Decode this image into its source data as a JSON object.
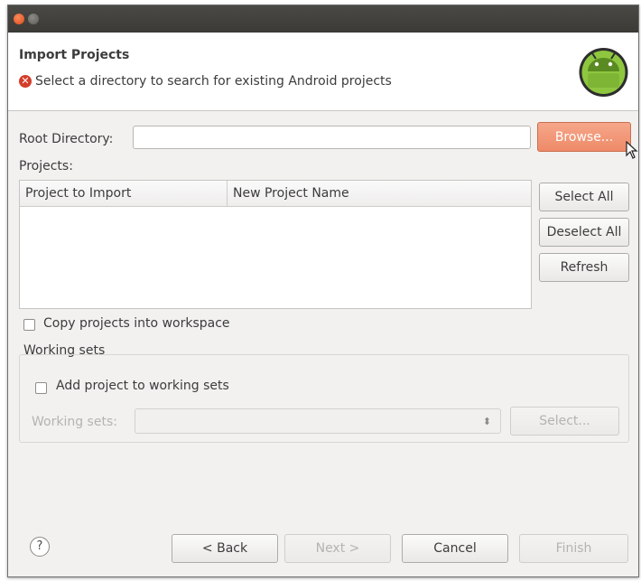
{
  "header": {
    "title": "Import Projects",
    "message": "Select a directory to search for existing Android projects"
  },
  "root": {
    "label": "Root Directory:",
    "value": "",
    "browse_label": "Browse..."
  },
  "projects": {
    "label": "Projects:",
    "columns": [
      "Project to Import",
      "New Project Name"
    ],
    "rows": [],
    "select_all_label": "Select All",
    "deselect_all_label": "Deselect All",
    "refresh_label": "Refresh"
  },
  "copy_projects": {
    "label": "Copy projects into workspace",
    "checked": false
  },
  "working_sets": {
    "group_label": "Working sets",
    "add_label": "Add project to working sets",
    "add_checked": false,
    "field_label": "Working sets:",
    "field_value": "",
    "select_label": "Select..."
  },
  "footer": {
    "help_glyph": "?",
    "back_label": "< Back",
    "next_label": "Next >",
    "cancel_label": "Cancel",
    "finish_label": "Finish"
  },
  "colors": {
    "accent": "#ee8a68",
    "error": "#d43d2a",
    "android_green": "#8ec63f"
  }
}
